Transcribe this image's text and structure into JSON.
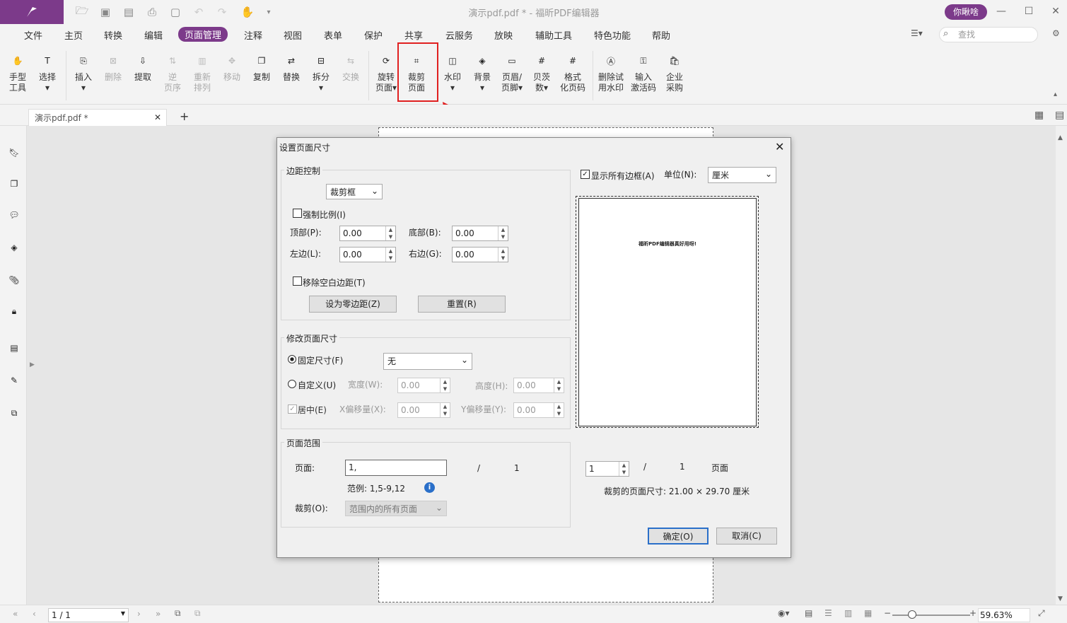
{
  "app": {
    "title": "演示pdf.pdf * - 福昕PDF编辑器",
    "user": "你瞅啥"
  },
  "menu": [
    "文件",
    "主页",
    "转换",
    "编辑",
    "页面管理",
    "注释",
    "视图",
    "表单",
    "保护",
    "共享",
    "云服务",
    "放映",
    "辅助工具",
    "特色功能",
    "帮助"
  ],
  "search_placeholder": "查找",
  "ribbon": {
    "hand": [
      "手型",
      "工具"
    ],
    "select": "选择",
    "insert": "插入",
    "delete": "删除",
    "extract": "提取",
    "reverse": [
      "逆",
      "页序"
    ],
    "rearrange": [
      "重新",
      "排列"
    ],
    "move": "移动",
    "copy": "复制",
    "replace": "替换",
    "split": "拆分",
    "swap": "交换",
    "rotate": [
      "旋转",
      "页面"
    ],
    "crop": [
      "裁剪",
      "页面"
    ],
    "watermark": "水印",
    "background": "背景",
    "header": [
      "页眉/",
      "页脚"
    ],
    "bates": [
      "贝茨",
      "数"
    ],
    "format": [
      "格式",
      "化页码"
    ],
    "remove_wm": [
      "删除试",
      "用水印"
    ],
    "activate": [
      "输入",
      "激活码"
    ],
    "enterprise": [
      "企业",
      "采购"
    ]
  },
  "tab": {
    "label": "演示pdf.pdf *"
  },
  "status": {
    "page": "1 / 1",
    "zoom": "59.63%"
  },
  "dialog": {
    "title": "设置页面尺寸",
    "margins": {
      "group": "边距控制",
      "box": "裁剪框",
      "force_ratio": "强制比例(I)",
      "top": "顶部(P):",
      "bottom": "底部(B):",
      "left": "左边(L):",
      "right": "右边(G):",
      "val": "0.00",
      "remove_blank": "移除空白边距(T)",
      "zero_btn": "设为零边距(Z)",
      "reset_btn": "重置(R)"
    },
    "size": {
      "group": "修改页面尺寸",
      "fixed": "固定尺寸(F)",
      "fixed_val": "无",
      "custom": "自定义(U)",
      "width": "宽度(W):",
      "height": "高度(H):",
      "center": "居中(E)",
      "xoff": "X偏移量(X):",
      "yoff": "Y偏移量(Y):",
      "val": "0.00"
    },
    "range": {
      "group": "页面范围",
      "pages": "页面:",
      "pages_val": "1,",
      "slash": "/",
      "total": "1",
      "example": "范例: 1,5-9,12",
      "crop": "裁剪(O):",
      "crop_val": "范围内的所有页面"
    },
    "preview": {
      "show_boxes": "显示所有边框(A)",
      "unit_label": "单位(N):",
      "unit": "厘米",
      "page_text": "福昕PDF编辑器真好用呀!",
      "page_num": "1",
      "slash": "/",
      "total": "1",
      "page_word": "页面",
      "crop_size": "裁剪的页面尺寸: 21.00 × 29.70  厘米"
    },
    "ok": "确定(O)",
    "cancel": "取消(C)"
  }
}
